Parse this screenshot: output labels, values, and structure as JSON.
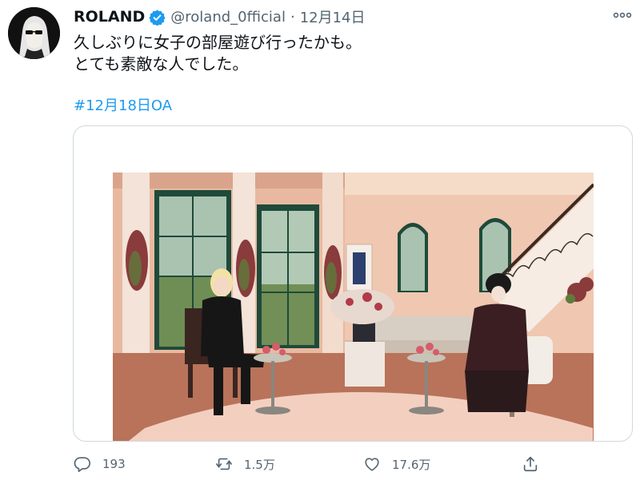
{
  "author": {
    "name": "ROLAND",
    "handle": "@roland_0fficial",
    "separator": "·",
    "date": "12月14日"
  },
  "tweet": {
    "lines": [
      "久しぶりに女子の部屋遊び行ったかも。",
      "とても素敵な人でした。"
    ],
    "hashtag": "#12月18日OA"
  },
  "actions": {
    "reply_count": "193",
    "retweet_count": "1.5万",
    "like_count": "17.6万"
  },
  "icons": {
    "verified": "verified-badge-icon",
    "more": "more-options-icon",
    "reply": "reply-icon",
    "retweet": "retweet-icon",
    "like": "like-heart-icon",
    "share": "share-icon"
  },
  "colors": {
    "accent": "#1d9bf0",
    "muted": "#536471",
    "text": "#0f1419"
  }
}
